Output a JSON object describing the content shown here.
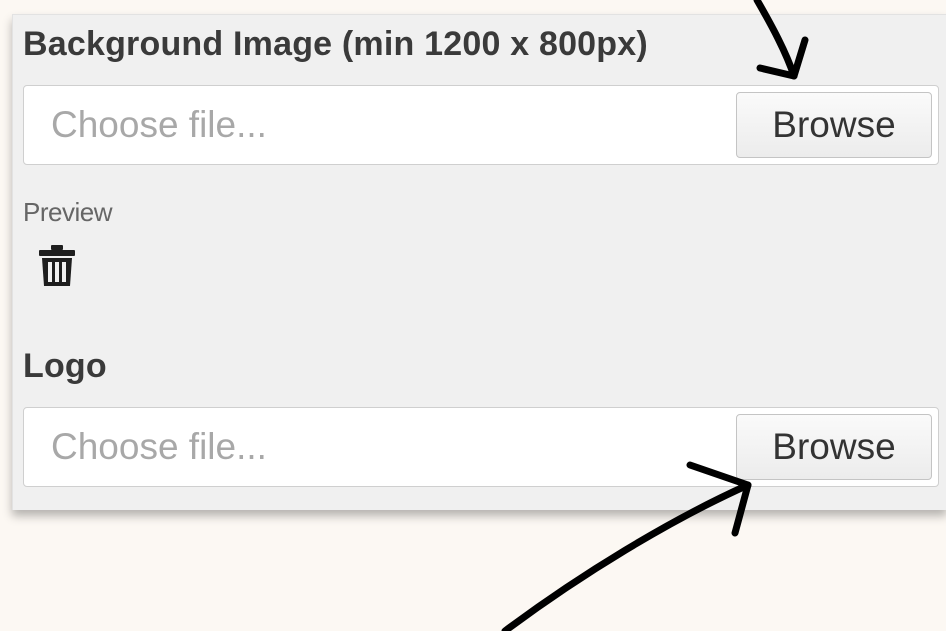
{
  "background_image": {
    "label": "Background Image (min 1200 x 800px)",
    "placeholder": "Choose file...",
    "browse_label": "Browse",
    "preview_label": "Preview"
  },
  "logo": {
    "label": "Logo",
    "placeholder": "Choose file...",
    "browse_label": "Browse"
  },
  "icons": {
    "delete": "trash-icon"
  },
  "colors": {
    "page_background": "#fcf8f3",
    "panel_background": "#f0f0f0",
    "label_text": "#3a3a3a",
    "placeholder_text": "#a8a8a8",
    "annotation_arrow": "#000000"
  }
}
